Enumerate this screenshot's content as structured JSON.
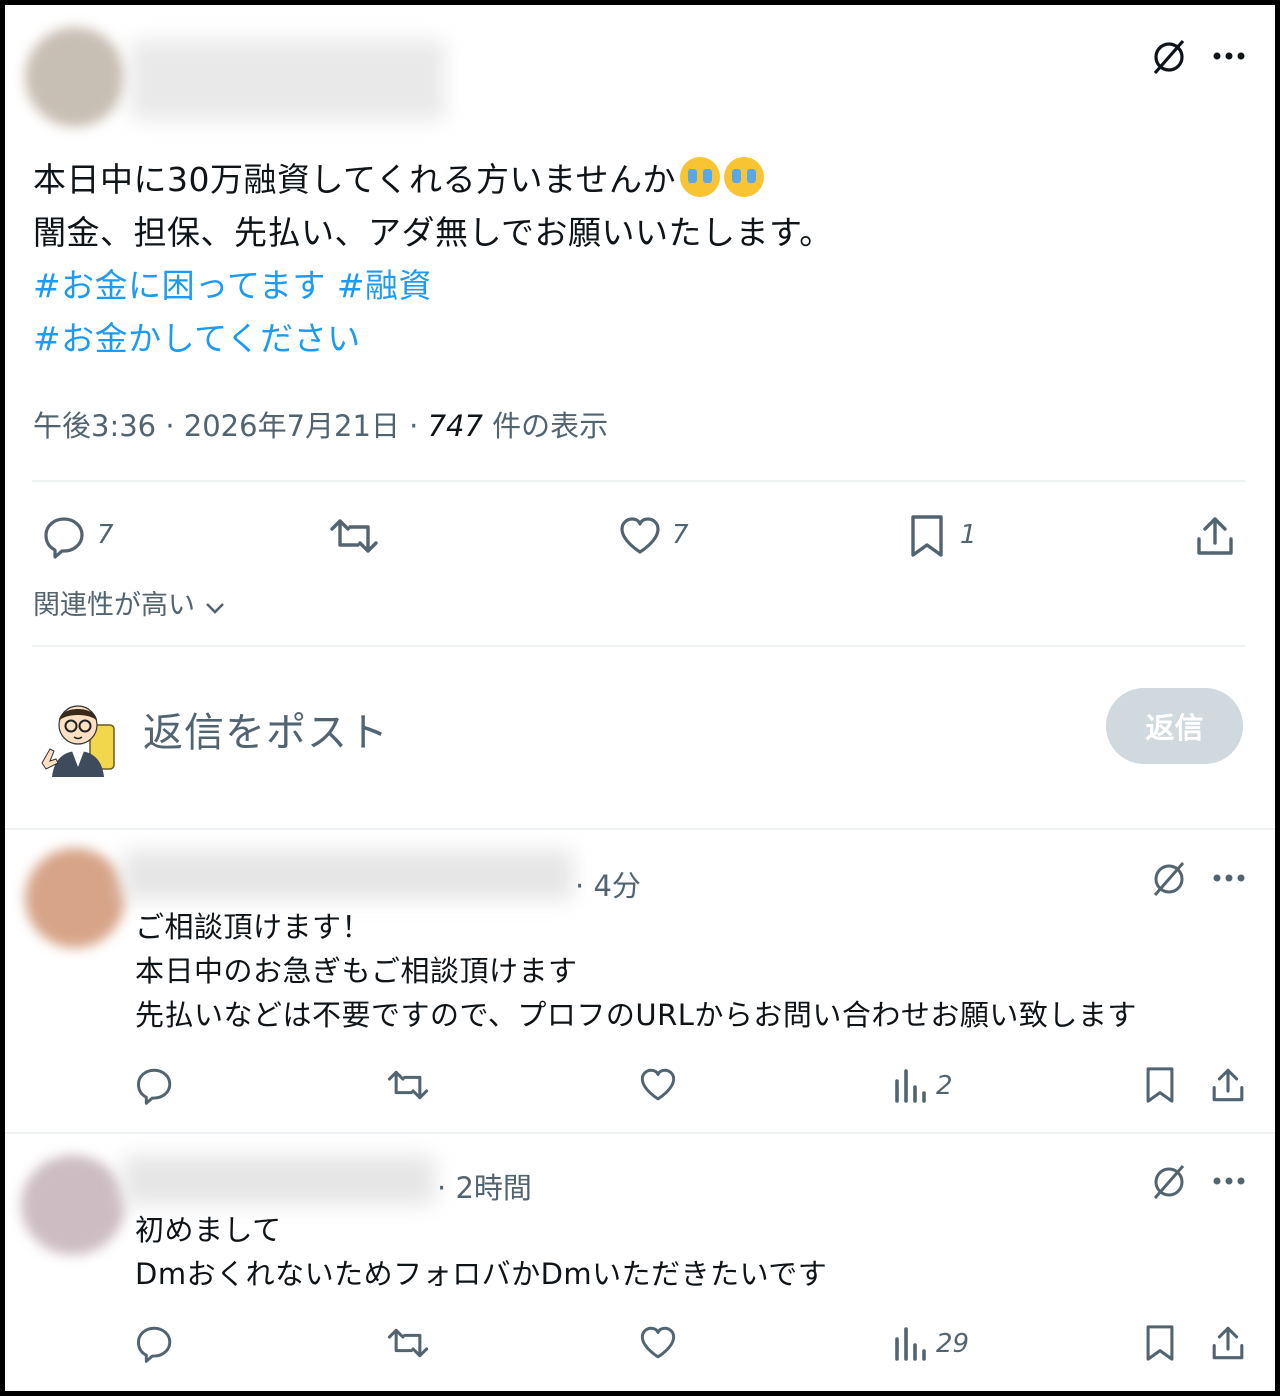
{
  "post": {
    "text_line1": "本日中に30万融資してくれる方いませんか",
    "emoji_name": "loudly-crying-face",
    "text_line2": "闇金、担保、先払い、アダ無しでお願いいたします。",
    "hashtag1": "#お金に困ってます",
    "hashtag2": "#融資",
    "hashtag3": "#お金かしてください",
    "time": "午後3:36",
    "date": "2026年7月21日",
    "views_count": "747",
    "views_label": "件の表示",
    "replies": "7",
    "likes": "7",
    "bookmarks": "1"
  },
  "sort": {
    "label": "関連性が高い"
  },
  "composer": {
    "placeholder": "返信をポスト",
    "button": "返信"
  },
  "replies": [
    {
      "time": "4分",
      "lines": [
        "ご相談頂けます！",
        "本日中のお急ぎもご相談頂けます",
        "先払いなどは不要ですので、プロフのURLからお問い合わせお願い致します"
      ],
      "views": "2"
    },
    {
      "time": "2時間",
      "lines": [
        "初めまして",
        "DmおくれないためフォロバかDmいただきたいです"
      ],
      "views": "29"
    }
  ],
  "colors": {
    "accent": "#1d9bf0",
    "muted": "#536471",
    "button": "#cfd9de"
  }
}
